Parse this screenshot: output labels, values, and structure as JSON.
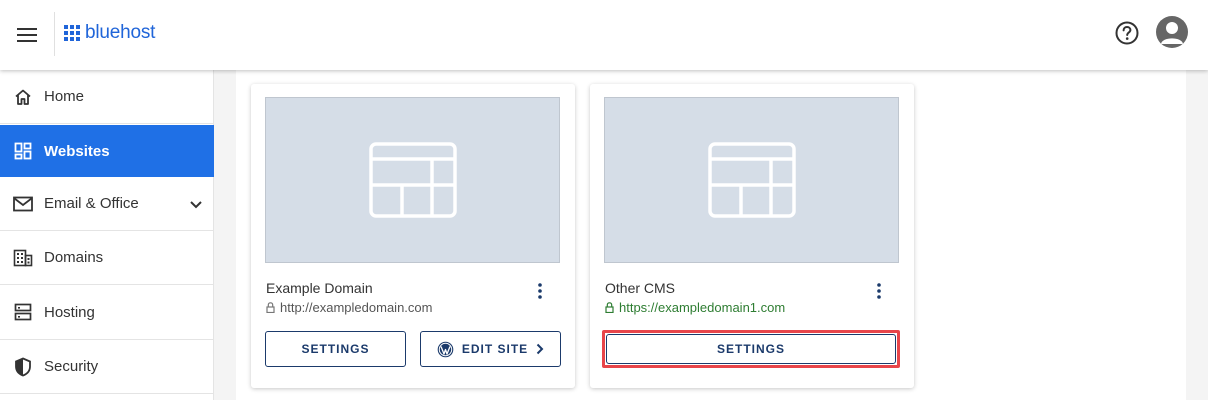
{
  "header": {
    "brand": "bluehost",
    "brand_color": "#2065d9",
    "menu_icon": "hamburger-menu-icon",
    "help_icon": "question-circle-icon",
    "avatar_icon": "user-avatar-icon"
  },
  "sidebar": {
    "items": [
      {
        "label": "Home",
        "icon": "home-icon",
        "active": false
      },
      {
        "label": "Websites",
        "icon": "dashboard-icon",
        "active": true
      },
      {
        "label": "Email & Office",
        "icon": "mail-icon",
        "active": false,
        "expandable": true
      },
      {
        "label": "Domains",
        "icon": "building-icon",
        "active": false
      },
      {
        "label": "Hosting",
        "icon": "server-icon",
        "active": false
      },
      {
        "label": "Security",
        "icon": "shield-icon",
        "active": false
      }
    ],
    "active_color": "#1f70e6"
  },
  "sites": [
    {
      "name": "Example Domain",
      "url": "http://exampledomain.com",
      "secure": false,
      "buttons": [
        "SETTINGS",
        "EDIT SITE"
      ]
    },
    {
      "name": "Other CMS",
      "url": "https://exampledomain1.com",
      "secure": true,
      "buttons": [
        "SETTINGS"
      ],
      "highlighted_button": "SETTINGS"
    }
  ],
  "colors": {
    "button_border": "#1b3a6b",
    "highlight": "#e8454a",
    "secure_url": "#2e7d32",
    "thumbnail_bg": "#d5dde7"
  }
}
